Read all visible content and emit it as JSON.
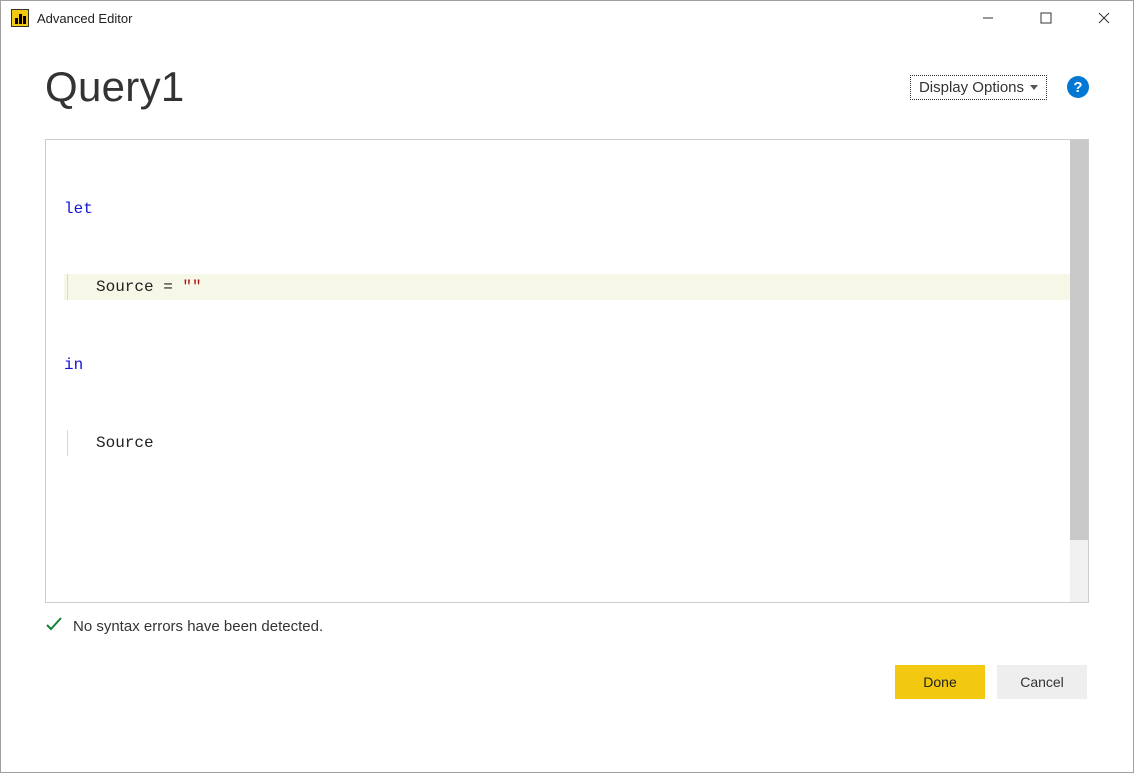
{
  "window": {
    "title": "Advanced Editor"
  },
  "header": {
    "page_title": "Query1",
    "display_options_label": "Display Options",
    "help_glyph": "?"
  },
  "editor": {
    "tokens": {
      "line1_kw": "let",
      "line2_ident": "Source = ",
      "line2_str": "\"\"",
      "line3_kw": "in",
      "line4_ident": "Source"
    }
  },
  "status": {
    "message": "No syntax errors have been detected."
  },
  "footer": {
    "done_label": "Done",
    "cancel_label": "Cancel"
  }
}
